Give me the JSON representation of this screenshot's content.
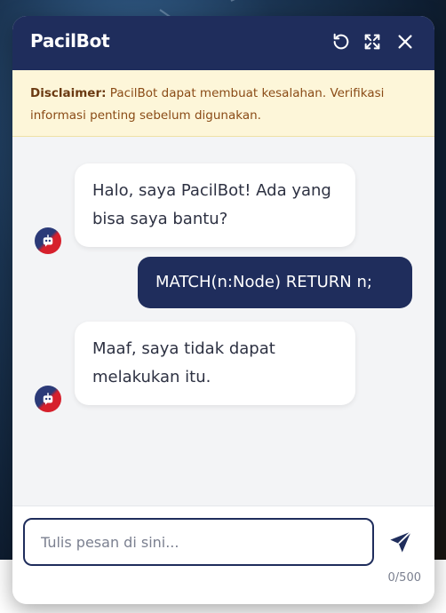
{
  "header": {
    "title": "PacilBot",
    "icons": [
      "refresh-icon",
      "expand-icon",
      "close-icon"
    ]
  },
  "disclaimer": {
    "label": "Disclaimer:",
    "text": " PacilBot dapat membuat kesalahan. Verifikasi informasi penting sebelum digunakan."
  },
  "messages": [
    {
      "from": "bot",
      "text": "Halo, saya PacilBot! Ada yang bisa saya bantu?"
    },
    {
      "from": "user",
      "text": "MATCH(n:Node) RETURN n;"
    },
    {
      "from": "bot",
      "text": "Maaf, saya tidak dapat melakukan itu."
    }
  ],
  "composer": {
    "placeholder": "Tulis pesan di sini...",
    "value": "",
    "counter": "0/500"
  },
  "colors": {
    "primary": "#1f2d5c",
    "disclaimer_bg": "#fdf6d9",
    "disclaimer_text": "#8a4b16",
    "chat_bg": "#f3f4f6",
    "avatar_red": "#d6202c"
  }
}
